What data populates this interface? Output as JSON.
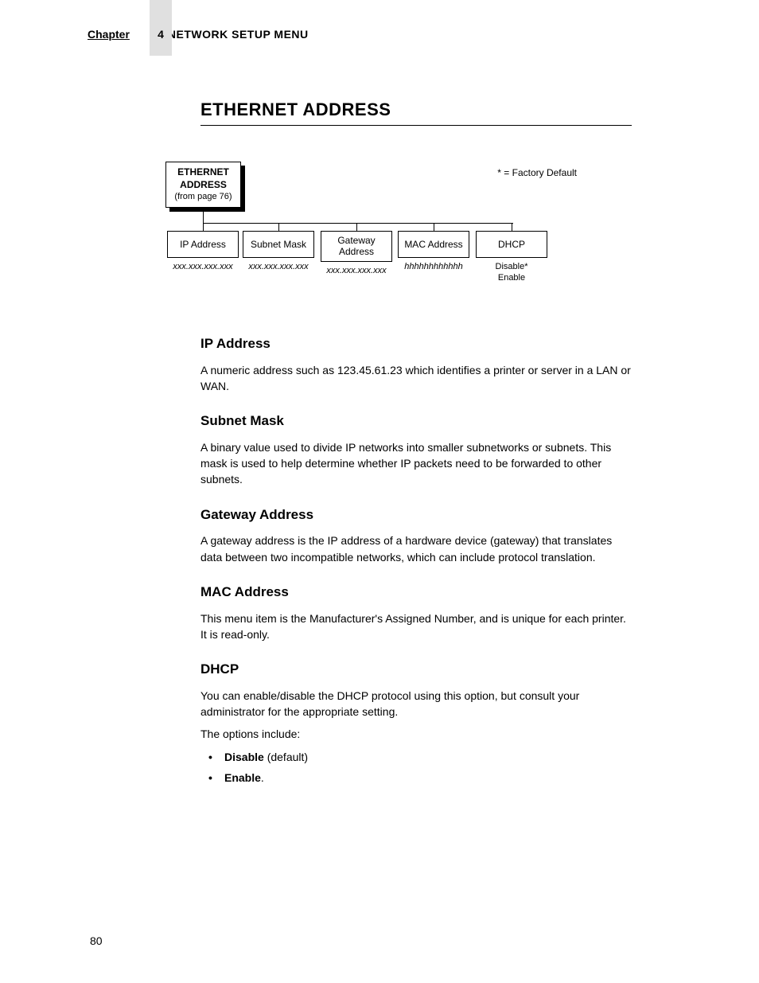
{
  "header": {
    "chapter_label": "Chapter",
    "chapter_number": "4",
    "chapter_title": "NETWORK SETUP MENU"
  },
  "main_title": "ETHERNET ADDRESS",
  "diagram": {
    "root": {
      "line1": "ETHERNET",
      "line2": "ADDRESS",
      "line3": "(from page 76)"
    },
    "factory_default": "* = Factory Default",
    "branches": [
      {
        "label": "IP Address",
        "value": "xxx.xxx.xxx.xxx",
        "italic": true
      },
      {
        "label": "Subnet Mask",
        "value": "xxx.xxx.xxx.xxx",
        "italic": true
      },
      {
        "label": "Gateway Address",
        "value": "xxx.xxx.xxx.xxx",
        "italic": true
      },
      {
        "label": "MAC Address",
        "value": "hhhhhhhhhhhh",
        "italic": true
      },
      {
        "label": "DHCP",
        "value": "Disable*\nEnable",
        "italic": false
      }
    ]
  },
  "sections": {
    "ip_address": {
      "title": "IP Address",
      "body": "A numeric address such as 123.45.61.23 which identifies a printer or server in a LAN or WAN."
    },
    "subnet_mask": {
      "title": "Subnet Mask",
      "body": "A binary value used to divide IP networks into smaller subnetworks or subnets. This mask is used to help determine whether IP packets need to be forwarded to other subnets."
    },
    "gateway_address": {
      "title": "Gateway Address",
      "body": "A gateway address is the IP address of a hardware device (gateway) that translates data between two incompatible networks, which can include protocol translation."
    },
    "mac_address": {
      "title": "MAC Address",
      "body": "This menu item is the Manufacturer's Assigned Number, and is unique for each printer. It is read-only."
    },
    "dhcp": {
      "title": "DHCP",
      "body1": "You can enable/disable the DHCP protocol using this option, but consult your administrator for the appropriate setting.",
      "body2": "The options include:",
      "bullets": {
        "b1_bold": "Disable",
        "b1_rest": " (default)",
        "b2_bold": "Enable",
        "b2_rest": "."
      }
    }
  },
  "page_number": "80"
}
